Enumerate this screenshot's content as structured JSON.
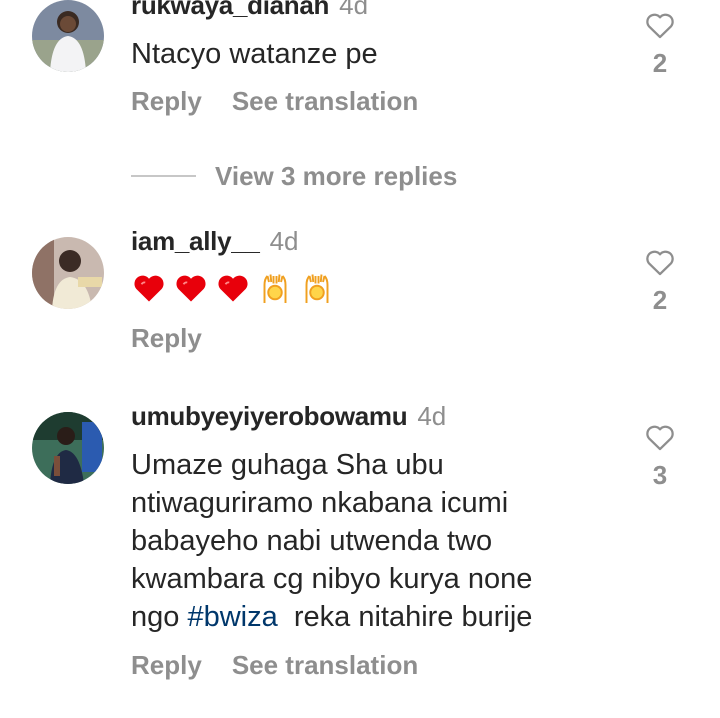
{
  "comments": [
    {
      "username": "rukwaya_dianah",
      "time": "4d",
      "text": "Ntacyo watanze pe",
      "reply_label": "Reply",
      "translate_label": "See translation",
      "likes": "2"
    },
    {
      "username": "iam_ally__",
      "time": "4d",
      "emojis": [
        "red-heart",
        "red-heart",
        "red-heart",
        "raising-hands",
        "raising-hands"
      ],
      "reply_label": "Reply",
      "likes": "2"
    },
    {
      "username": "umubyeyiyerobowamu",
      "time": "4d",
      "text_lines": [
        "Umaze guhaga Sha ubu",
        "ntiwaguriramo nkabana icumi",
        "babayeho nabi utwenda two",
        "kwambara cg nibyo kurya none"
      ],
      "text_last_prefix": "ngo ",
      "hashtag": "#bwiza",
      "text_last_suffix": "  reka nitahire burije",
      "reply_label": "Reply",
      "translate_label": "See translation",
      "likes": "3"
    }
  ],
  "view_more_replies": "View 3 more replies",
  "colors": {
    "text": "#262626",
    "secondary": "#8e8e8e",
    "hashtag": "#00376b",
    "heart_emoji": "#e8000b"
  }
}
